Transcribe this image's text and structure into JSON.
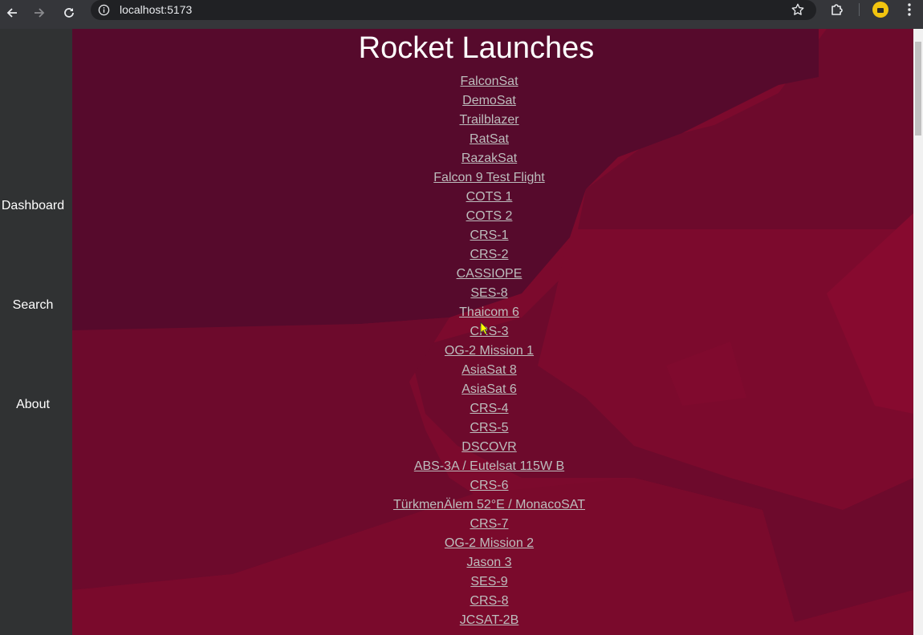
{
  "browser": {
    "url": "localhost:5173",
    "icons": [
      "back-arrow-icon",
      "forward-arrow-icon",
      "reload-icon",
      "site-info-icon",
      "bookmark-star-icon",
      "extensions-icon",
      "profile-avatar-icon",
      "menu-kebab-icon"
    ]
  },
  "sidebar": {
    "items": [
      {
        "label": "Dashboard"
      },
      {
        "label": "Search"
      },
      {
        "label": "About"
      }
    ]
  },
  "main": {
    "title": "Rocket Launches",
    "launches": [
      "FalconSat",
      "DemoSat",
      "Trailblazer",
      "RatSat",
      "RazakSat",
      "Falcon 9 Test Flight",
      "COTS 1",
      "COTS 2",
      "CRS-1",
      "CRS-2",
      "CASSIOPE",
      "SES-8",
      "Thaicom 6",
      "CRS-3",
      "OG-2 Mission 1",
      "AsiaSat 8",
      "AsiaSat 6",
      "CRS-4",
      "CRS-5",
      "DSCOVR",
      "ABS-3A / Eutelsat 115W B",
      "CRS-6",
      "TürkmenÄlem 52°E / MonacoSAT",
      "CRS-7",
      "OG-2 Mission 2",
      "Jason 3",
      "SES-9",
      "CRS-8",
      "JCSAT-2B"
    ]
  },
  "colors": {
    "background_dark": "#560a2c",
    "background_mid": "#6d0a2c",
    "background_bright": "#7c0a2d",
    "link": "#bdbdbd",
    "sidebar": "#303233"
  }
}
